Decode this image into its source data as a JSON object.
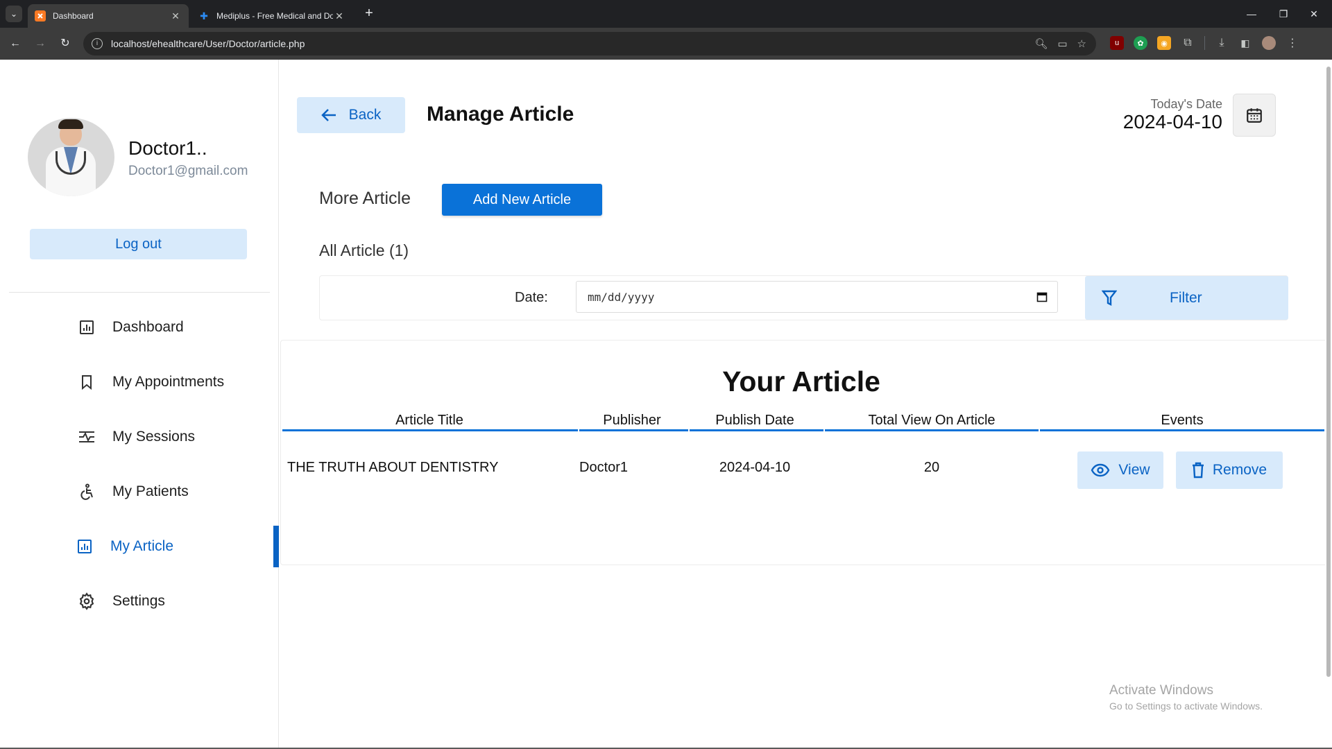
{
  "browser": {
    "tabs": [
      {
        "title": "Dashboard",
        "active": true
      },
      {
        "title": "Mediplus - Free Medical and Do",
        "active": false
      }
    ],
    "url": "localhost/ehealthcare/User/Doctor/article.php"
  },
  "profile": {
    "name": "Doctor1..",
    "email": "Doctor1@gmail.com",
    "logout_label": "Log out"
  },
  "sidebar": {
    "items": [
      {
        "label": "Dashboard",
        "icon": "dashboard-icon"
      },
      {
        "label": "My Appointments",
        "icon": "bookmark-icon"
      },
      {
        "label": "My Sessions",
        "icon": "sessions-icon"
      },
      {
        "label": "My Patients",
        "icon": "accessibility-icon"
      },
      {
        "label": "My Article",
        "icon": "article-chart-icon",
        "active": true
      },
      {
        "label": "Settings",
        "icon": "gear-icon"
      }
    ]
  },
  "header": {
    "back_label": "Back",
    "title": "Manage Article",
    "today_label": "Today's Date",
    "today_value": "2024-04-10"
  },
  "main": {
    "more_label": "More Article",
    "add_button_label": "Add New Article",
    "all_label": "All Article (1)"
  },
  "filter": {
    "date_label": "Date:",
    "date_placeholder": "mm/dd/yyyy",
    "button_label": "Filter"
  },
  "table": {
    "title": "Your Article",
    "headers": [
      "Article Title",
      "Publisher",
      "Publish Date",
      "Total View On Article",
      "Events"
    ],
    "rows": [
      {
        "title": "THE TRUTH ABOUT DENTISTRY",
        "publisher": "Doctor1",
        "publish_date": "2024-04-10",
        "views": "20"
      }
    ],
    "view_label": "View",
    "remove_label": "Remove"
  },
  "watermark": {
    "line1": "Activate Windows",
    "line2": "Go to Settings to activate Windows."
  },
  "colors": {
    "accent": "#0a72d8",
    "accent_text": "#0a63c4",
    "light_button": "#d8eafb"
  }
}
